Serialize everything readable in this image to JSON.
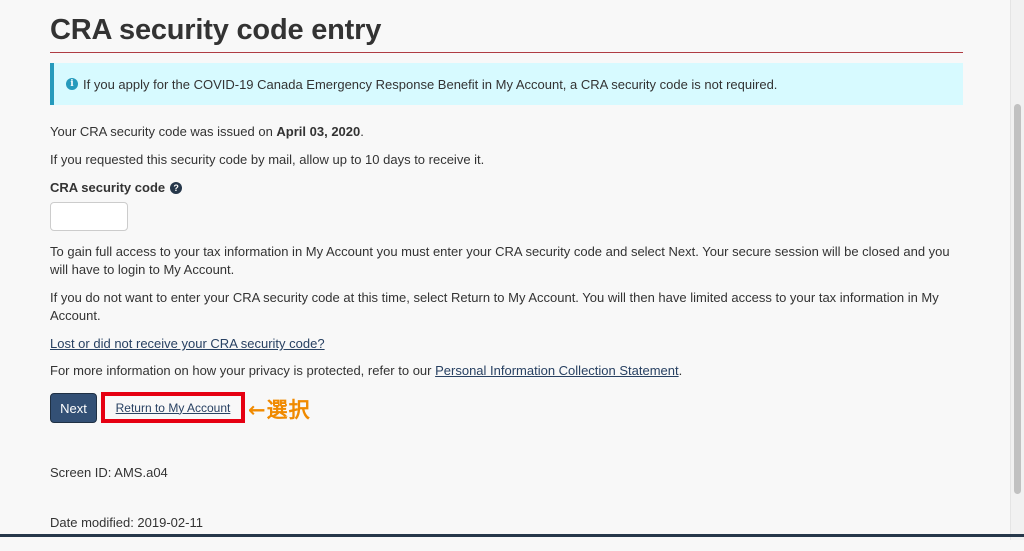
{
  "page": {
    "title": "CRA security code entry"
  },
  "alert": {
    "icon": "info-icon",
    "icon_glyph": "i",
    "text": "If you apply for the COVID-19 Canada Emergency Response Benefit in My Account, a CRA security code is not required."
  },
  "issued": {
    "prefix": "Your CRA security code was issued on ",
    "date": "April 03, 2020",
    "suffix": "."
  },
  "mail_note": "If you requested this security code by mail, allow up to 10 days to receive it.",
  "field": {
    "label": "CRA security code",
    "help_icon_glyph": "?",
    "value": ""
  },
  "instructions": {
    "full_access": "To gain full access to your tax information in My Account you must enter your CRA security code and select Next. Your secure session will be closed and you will have to login to My Account.",
    "limited_access": "If you do not want to enter your CRA security code at this time, select Return to My Account. You will then have limited access to your tax information in My Account."
  },
  "lost_link": "Lost or did not receive your CRA security code?",
  "privacy": {
    "prefix": "For more information on how your privacy is protected, refer to our ",
    "link": "Personal Information Collection Statement",
    "suffix": "."
  },
  "buttons": {
    "next": "Next",
    "return": "Return to My Account"
  },
  "annotation": "←選択",
  "footer": {
    "screen_id": "Screen ID: AMS.a04",
    "date_modified": "Date modified: 2019-02-11"
  },
  "colors": {
    "title_rule": "#af3c43",
    "alert_bg": "#d7faff",
    "alert_border": "#269abc",
    "primary_button": "#335075",
    "highlight_box": "#e60012",
    "annotation": "#f08a00",
    "link": "#284162"
  }
}
